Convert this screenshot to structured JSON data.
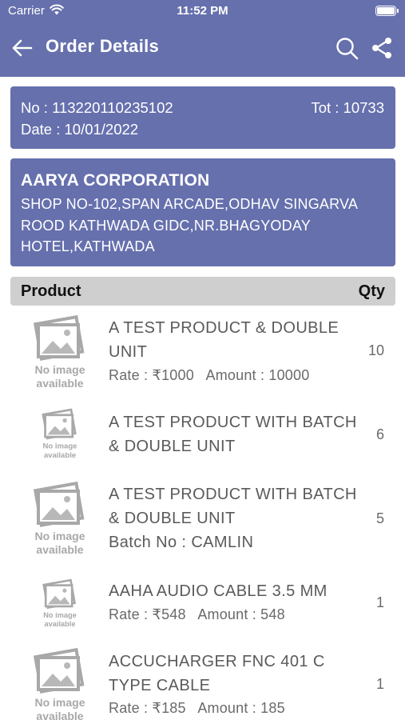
{
  "status": {
    "carrier": "Carrier",
    "time": "11:52 PM"
  },
  "header": {
    "title": "Order Details",
    "back_icon": "arrow-left-icon",
    "search_icon": "search-icon",
    "share_icon": "share-icon"
  },
  "order": {
    "no": "No : 113220110235102",
    "tot": "Tot : 10733",
    "date": "Date : 10/01/2022"
  },
  "customer": {
    "name": "AARYA CORPORATION",
    "address_lines": [
      "SHOP NO-102,SPAN ARCADE,ODHAV SINGARVA",
      "ROOD KATHWADA GIDC,NR.BHAGYODAY",
      "HOTEL,KATHWADA"
    ]
  },
  "table": {
    "product_header": "Product",
    "qty_header": "Qty"
  },
  "items": [
    {
      "name_lines": [
        "A TEST PRODUCT & DOUBLE",
        "UNIT"
      ],
      "detail": "Rate : ₹1000   Amount : 10000",
      "qty": "10",
      "image_text": [
        "No image",
        "available"
      ]
    },
    {
      "name_lines": [
        "A TEST PRODUCT WITH BATCH",
        "& DOUBLE UNIT"
      ],
      "detail": "",
      "qty": "6",
      "image_text": [
        "No image",
        "available"
      ]
    },
    {
      "name_lines": [
        "A TEST PRODUCT WITH BATCH",
        "& DOUBLE UNIT",
        "Batch No : CAMLIN"
      ],
      "detail": "",
      "qty": "5",
      "image_text": [
        "No image",
        "available"
      ]
    },
    {
      "name_lines": [
        "AAHA AUDIO CABLE 3.5 MM"
      ],
      "detail": "Rate : ₹548   Amount : 548",
      "qty": "1",
      "image_text": [
        "No image",
        "available"
      ]
    },
    {
      "name_lines": [
        "ACCUCHARGER FNC 401 C",
        "TYPE CABLE"
      ],
      "detail": "Rate : ₹185   Amount : 185",
      "qty": "1",
      "image_text": [
        "No image",
        "available"
      ]
    }
  ],
  "colors": {
    "primary": "#6670ad",
    "header_bg": "#6670ad",
    "table_header_bg": "#cfcfcf"
  }
}
